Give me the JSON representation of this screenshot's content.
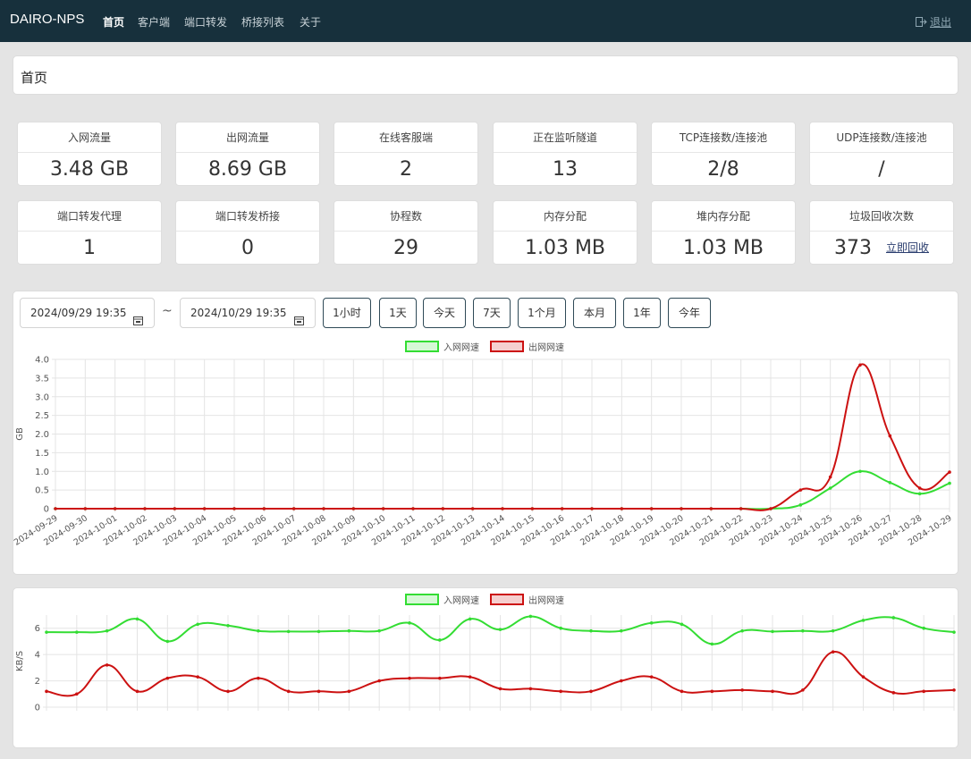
{
  "nav": {
    "brand": "DAIRO-NPS",
    "items": [
      {
        "label": "首页",
        "active": true
      },
      {
        "label": "客户端",
        "active": false
      },
      {
        "label": "端口转发",
        "active": false
      },
      {
        "label": "桥接列表",
        "active": false
      },
      {
        "label": "关于",
        "active": false
      }
    ],
    "logout": "退出"
  },
  "page_title": "首页",
  "stats": [
    {
      "label": "入网流量",
      "value": "3.48 GB"
    },
    {
      "label": "出网流量",
      "value": "8.69 GB"
    },
    {
      "label": "在线客服端",
      "value": "2"
    },
    {
      "label": "正在监听隧道",
      "value": "13"
    },
    {
      "label": "TCP连接数/连接池",
      "value": "2/8"
    },
    {
      "label": "UDP连接数/连接池",
      "value": "/"
    },
    {
      "label": "端口转发代理",
      "value": "1"
    },
    {
      "label": "端口转发桥接",
      "value": "0"
    },
    {
      "label": "协程数",
      "value": "29"
    },
    {
      "label": "内存分配",
      "value": "1.03 MB"
    },
    {
      "label": "堆内存分配",
      "value": "1.03 MB"
    },
    {
      "label": "垃圾回收次数",
      "value": "373",
      "link": "立即回收"
    }
  ],
  "filter": {
    "start": "2024/09/29 19:35",
    "end": "2024/10/29 19:35",
    "separator": "~",
    "ranges": [
      "1小时",
      "1天",
      "今天",
      "7天",
      "1个月",
      "本月",
      "1年",
      "今年"
    ]
  },
  "colors": {
    "in": "#33dd33",
    "out": "#cc1111",
    "nav_bg": "#17303c"
  },
  "chart_data": [
    {
      "type": "line",
      "ylabel": "GB",
      "ylim": [
        0,
        4.0
      ],
      "yticks": [
        "0",
        "0.5",
        "1.0",
        "1.5",
        "2.0",
        "2.5",
        "3.0",
        "3.5",
        "4.0"
      ],
      "legend_position": "top",
      "grid": true,
      "x": [
        "2024-09-29",
        "2024-09-30",
        "2024-10-01",
        "2024-10-02",
        "2024-10-03",
        "2024-10-04",
        "2024-10-05",
        "2024-10-06",
        "2024-10-07",
        "2024-10-08",
        "2024-10-09",
        "2024-10-10",
        "2024-10-11",
        "2024-10-12",
        "2024-10-13",
        "2024-10-14",
        "2024-10-15",
        "2024-10-16",
        "2024-10-17",
        "2024-10-18",
        "2024-10-19",
        "2024-10-20",
        "2024-10-21",
        "2024-10-22",
        "2024-10-23",
        "2024-10-24",
        "2024-10-25",
        "2024-10-26",
        "2024-10-27",
        "2024-10-28",
        "2024-10-29"
      ],
      "series": [
        {
          "name": "入网网速",
          "values": [
            0,
            0,
            0,
            0,
            0,
            0,
            0,
            0,
            0,
            0,
            0,
            0,
            0,
            0,
            0,
            0,
            0,
            0,
            0,
            0,
            0,
            0,
            0,
            0,
            0,
            0.1,
            0.55,
            1.0,
            0.7,
            0.4,
            0.68
          ]
        },
        {
          "name": "出网网速",
          "values": [
            0,
            0,
            0,
            0,
            0,
            0,
            0,
            0,
            0,
            0,
            0,
            0,
            0,
            0,
            0,
            0,
            0,
            0,
            0,
            0,
            0,
            0,
            0,
            0,
            0,
            0.5,
            0.85,
            3.85,
            1.95,
            0.55,
            0.98
          ]
        }
      ]
    },
    {
      "type": "line",
      "ylabel": "KB/S",
      "ylim": [
        0,
        7
      ],
      "yticks": [
        "0",
        "2",
        "4",
        "6"
      ],
      "legend_position": "top",
      "grid": true,
      "series": [
        {
          "name": "入网网速",
          "values": [
            5.7,
            5.7,
            5.8,
            6.7,
            5.0,
            6.3,
            6.2,
            5.8,
            5.75,
            5.75,
            5.8,
            5.8,
            6.4,
            5.1,
            6.7,
            5.9,
            6.9,
            6.0,
            5.8,
            5.8,
            6.4,
            6.3,
            4.8,
            5.8,
            5.75,
            5.8,
            5.8,
            6.6,
            6.8,
            6.0,
            5.7
          ]
        },
        {
          "name": "出网网速",
          "values": [
            1.2,
            1.0,
            3.2,
            1.2,
            2.2,
            2.3,
            1.2,
            2.2,
            1.2,
            1.2,
            1.2,
            2.0,
            2.2,
            2.2,
            2.3,
            1.4,
            1.4,
            1.2,
            1.2,
            2.0,
            2.3,
            1.2,
            1.2,
            1.3,
            1.2,
            1.3,
            4.2,
            2.3,
            1.1,
            1.2,
            1.3
          ]
        }
      ]
    }
  ]
}
